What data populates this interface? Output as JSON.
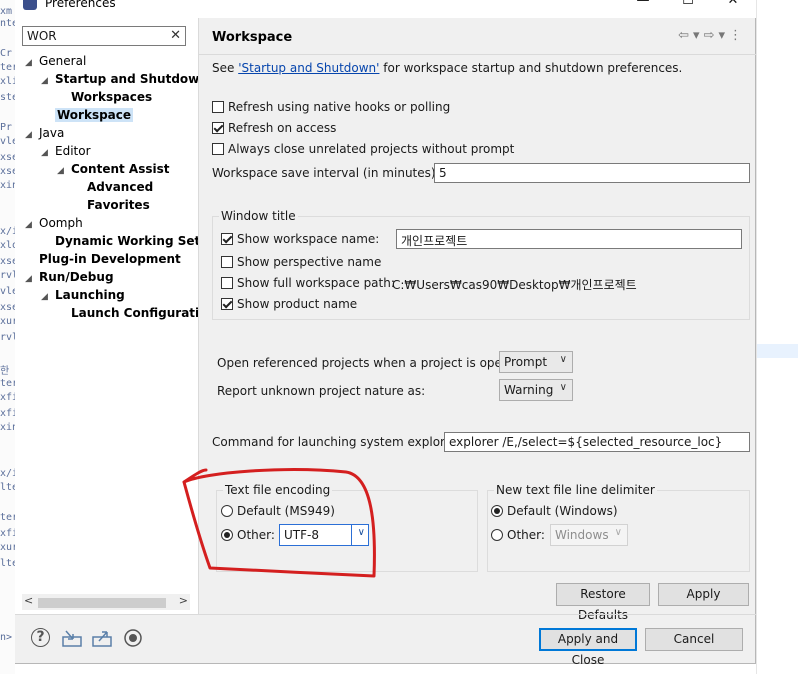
{
  "window": {
    "title": "Preferences"
  },
  "window_controls": {
    "minimize": "—",
    "maximize": "☐",
    "close": "✕"
  },
  "filter": {
    "value": "WOR",
    "clear": "✕"
  },
  "tree": [
    {
      "label": "General",
      "twisty": "◢",
      "level": 0,
      "bold": false
    },
    {
      "label": "Startup and Shutdown",
      "twisty": "◢",
      "level": 1,
      "bold": true
    },
    {
      "label": "Workspaces",
      "twisty": "",
      "level": 2,
      "bold": true
    },
    {
      "label": "Workspace",
      "twisty": "",
      "level": 1,
      "bold": true,
      "selected": true
    },
    {
      "label": "Java",
      "twisty": "◢",
      "level": 0,
      "bold": false
    },
    {
      "label": "Editor",
      "twisty": "◢",
      "level": 1,
      "bold": false
    },
    {
      "label": "Content Assist",
      "twisty": "◢",
      "level": 2,
      "bold": true
    },
    {
      "label": "Advanced",
      "twisty": "",
      "level": 3,
      "bold": true
    },
    {
      "label": "Favorites",
      "twisty": "",
      "level": 3,
      "bold": true
    },
    {
      "label": "Oomph",
      "twisty": "◢",
      "level": 0,
      "bold": false
    },
    {
      "label": "Dynamic Working Sets",
      "twisty": "",
      "level": 1,
      "bold": true
    },
    {
      "label": "Plug-in Development",
      "twisty": "",
      "level": 0,
      "bold": true
    },
    {
      "label": "Run/Debug",
      "twisty": "◢",
      "level": 0,
      "bold": true
    },
    {
      "label": "Launching",
      "twisty": "◢",
      "level": 1,
      "bold": true
    },
    {
      "label": "Launch Configurations",
      "twisty": "",
      "level": 2,
      "bold": true
    }
  ],
  "page": {
    "title": "Workspace",
    "see_prefix": "See ",
    "see_link": "'Startup and Shutdown'",
    "see_suffix": " for workspace startup and shutdown preferences.",
    "refresh_native": {
      "label": "Refresh using native hooks or polling",
      "checked": false
    },
    "refresh_access": {
      "label": "Refresh on access",
      "checked": true
    },
    "always_close": {
      "label": "Always close unrelated projects without prompt",
      "checked": false
    },
    "save_interval_label": "Workspace save interval (in minutes):",
    "save_interval_value": "5",
    "window_title_group": "Window title",
    "show_ws_name": {
      "label": "Show workspace name:",
      "checked": true,
      "value": "개인프로젝트"
    },
    "show_perspective": {
      "label": "Show perspective name",
      "checked": false
    },
    "show_full_path": {
      "label": "Show full workspace path:",
      "checked": false,
      "value": "C:₩Users₩cas90₩Desktop₩개인프로젝트"
    },
    "show_product": {
      "label": "Show product name",
      "checked": true
    },
    "open_ref_label": "Open referenced projects when a project is opened:",
    "open_ref_value": "Prompt",
    "report_label": "Report unknown project nature as:",
    "report_value": "Warning",
    "cmd_label": "Command for launching system explorer:",
    "cmd_value": "explorer /E,/select=${selected_resource_loc}",
    "encoding_group": "Text file encoding",
    "encoding_default": {
      "label": "Default (MS949)",
      "checked": false
    },
    "encoding_other": {
      "label": "Other:",
      "checked": true,
      "value": "UTF-8"
    },
    "delimiter_group": "New text file line delimiter",
    "delimiter_default": {
      "label": "Default (Windows)",
      "checked": true
    },
    "delimiter_other": {
      "label": "Other:",
      "checked": false,
      "value": "Windows"
    },
    "restore_defaults": "Restore Defaults",
    "apply": "Apply"
  },
  "footer": {
    "apply_close": "Apply and Close",
    "cancel": "Cancel",
    "help": "?"
  },
  "colors": {
    "selection": "#cde3f7",
    "link": "#0645ad",
    "default_button": "#0078d7",
    "annotation": "#d41f1f"
  }
}
